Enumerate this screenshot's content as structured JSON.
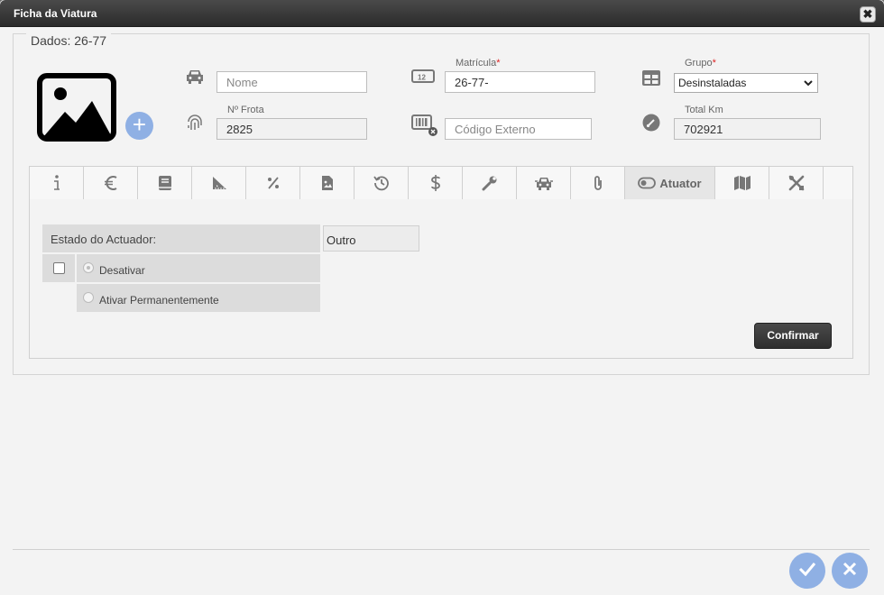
{
  "window": {
    "title": "Ficha da Viatura",
    "close_label": "✖"
  },
  "dados": {
    "legend": "Dados: 26-77"
  },
  "fields": {
    "nome": {
      "placeholder": "Nome",
      "value": ""
    },
    "matricula": {
      "label": "Matrícula",
      "required_mark": "*",
      "value": "26-77-"
    },
    "grupo": {
      "label": "Grupo",
      "required_mark": "*",
      "value": "Desinstaladas"
    },
    "frota": {
      "label": "Nº Frota",
      "value": "2825"
    },
    "codigo_externo": {
      "placeholder": "Código Externo",
      "value": ""
    },
    "total_km": {
      "label": "Total Km",
      "value": "702921"
    }
  },
  "tabs": {
    "items": [
      {
        "icon": "info-icon"
      },
      {
        "icon": "euro-icon"
      },
      {
        "icon": "book-icon"
      },
      {
        "icon": "ruler-triangle-icon"
      },
      {
        "icon": "percent-icon"
      },
      {
        "icon": "file-image-icon"
      },
      {
        "icon": "history-icon"
      },
      {
        "icon": "dollar-icon"
      },
      {
        "icon": "wrench-icon"
      },
      {
        "icon": "car-front-icon"
      },
      {
        "icon": "paperclip-icon"
      },
      {
        "icon": "toggle-icon",
        "label": "Atuator",
        "active": true
      },
      {
        "icon": "map-icon"
      },
      {
        "icon": "tools-icon"
      }
    ]
  },
  "atuator": {
    "estado_label": "Estado do Actuador:",
    "estado_value": "Outro",
    "options": [
      {
        "label": "Desativar",
        "checked": true
      },
      {
        "label": "Ativar Permanentemente",
        "checked": false
      }
    ],
    "confirm_label": "Confirmar"
  },
  "colors": {
    "accent": "#8fb0e4",
    "titlebar": "#2b2b2b",
    "required": "#dd2222"
  }
}
